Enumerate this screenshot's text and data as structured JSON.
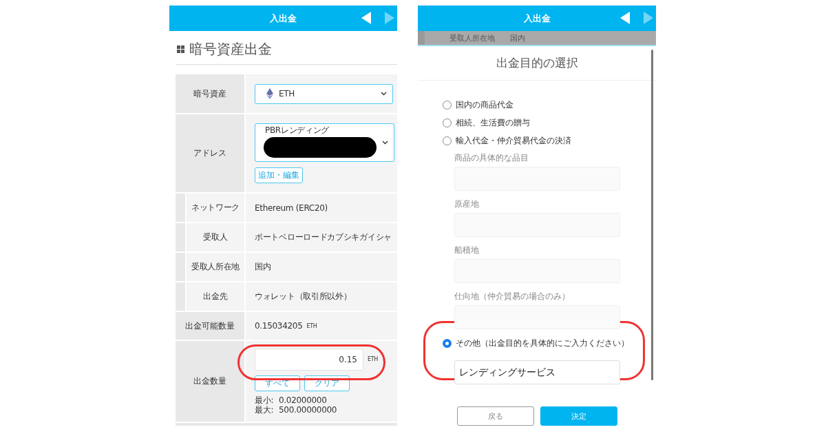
{
  "left_panel": {
    "header": {
      "title": "入出金",
      "nav": [
        {
          "kind": "prev",
          "disabled": false
        },
        {
          "kind": "next",
          "disabled": true
        }
      ]
    },
    "page_title": "暗号資産出金",
    "rows": [
      {
        "kind": "select",
        "label": "暗号資産",
        "value": "ETH"
      },
      {
        "kind": "address",
        "label": "アドレス",
        "value": "PBRレンディング",
        "redacted": true,
        "button": "追加・編集"
      },
      {
        "kind": "detail",
        "label": "ネットワーク",
        "value": "Ethereum (ERC20)"
      },
      {
        "kind": "detail",
        "label": "受取人",
        "value": "ポートベローロードカブシキガイシャ"
      },
      {
        "kind": "detail",
        "label": "受取人所在地",
        "value": "国内"
      },
      {
        "kind": "detail",
        "label": "出金先",
        "value": "ウォレット（取引所以外）"
      },
      {
        "kind": "text",
        "label": "出金可能数量",
        "value": "0.15034205",
        "unit": "ETH"
      },
      {
        "kind": "amount",
        "label": "出金数量",
        "value": "0.15",
        "unit": "ETH",
        "highlighted": true,
        "buttons": [
          "すべて",
          "クリア"
        ],
        "limits": [
          {
            "label": "最小:",
            "value": "0.02000000"
          },
          {
            "label": "最大:",
            "value": "500.00000000"
          }
        ]
      }
    ]
  },
  "right_panel": {
    "header": {
      "title": "入出金",
      "nav": [
        {
          "kind": "prev",
          "disabled": false
        },
        {
          "kind": "next",
          "disabled": true
        }
      ]
    },
    "background_row": {
      "label": "受取人所在地",
      "value": "国内"
    },
    "modal": {
      "title": "出金目的の選択",
      "options": [
        {
          "label": "国内の商品代金",
          "selected": false
        },
        {
          "label": "相続、生活費の贈与",
          "selected": false
        },
        {
          "label": "輸入代金・仲介貿易代金の決済",
          "selected": false,
          "fields": [
            {
              "label": "商品の具体的な品目"
            },
            {
              "label": "原産地"
            },
            {
              "label": "船積地"
            },
            {
              "label": "仕向地（仲介貿易の場合のみ）"
            }
          ]
        },
        {
          "label": "その他（出金目的を具体的にご入力ください）",
          "selected": true,
          "highlighted": true,
          "input": "レンディングサービス"
        }
      ],
      "buttons": [
        {
          "label": "戻る",
          "kind": "secondary"
        },
        {
          "label": "決定",
          "kind": "primary"
        }
      ]
    }
  }
}
